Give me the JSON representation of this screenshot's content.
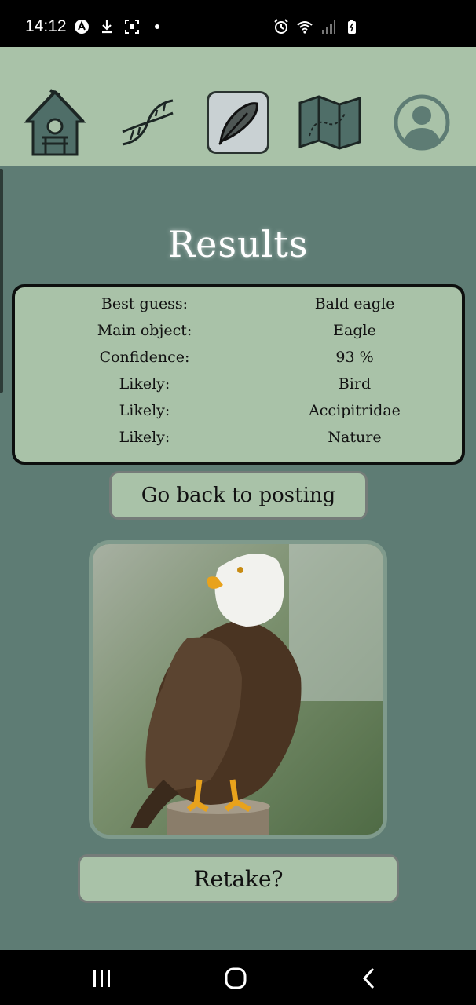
{
  "status_bar": {
    "time": "14:12",
    "left_icons": [
      "app-logo-icon",
      "download-icon",
      "screenshot-icon",
      "dot-icon"
    ],
    "right_icons": [
      "alarm-icon",
      "wifi-icon",
      "signal-icon",
      "battery-icon"
    ]
  },
  "top_nav": {
    "items": [
      {
        "name": "birdhouse-icon",
        "active": false
      },
      {
        "name": "dna-icon",
        "active": false
      },
      {
        "name": "feather-icon",
        "active": true
      },
      {
        "name": "map-icon",
        "active": false
      },
      {
        "name": "profile-icon",
        "active": false
      }
    ]
  },
  "results": {
    "title": "Results",
    "rows": [
      {
        "label": "Best guess:",
        "value": "Bald eagle"
      },
      {
        "label": "Main object:",
        "value": "Eagle"
      },
      {
        "label": "Confidence:",
        "value": "93 %"
      },
      {
        "label": "Likely:",
        "value": "Bird"
      },
      {
        "label": "Likely:",
        "value": "Accipitridae"
      },
      {
        "label": "Likely:",
        "value": "Nature"
      }
    ]
  },
  "buttons": {
    "back_label": "Go back to posting",
    "retake_label": "Retake?"
  },
  "system_nav": {
    "items": [
      "recent-apps-icon",
      "home-icon",
      "back-icon"
    ]
  },
  "colors": {
    "background": "#5e7c74",
    "panel": "#a9c2a8",
    "active_tab": "#c9d1d3"
  }
}
